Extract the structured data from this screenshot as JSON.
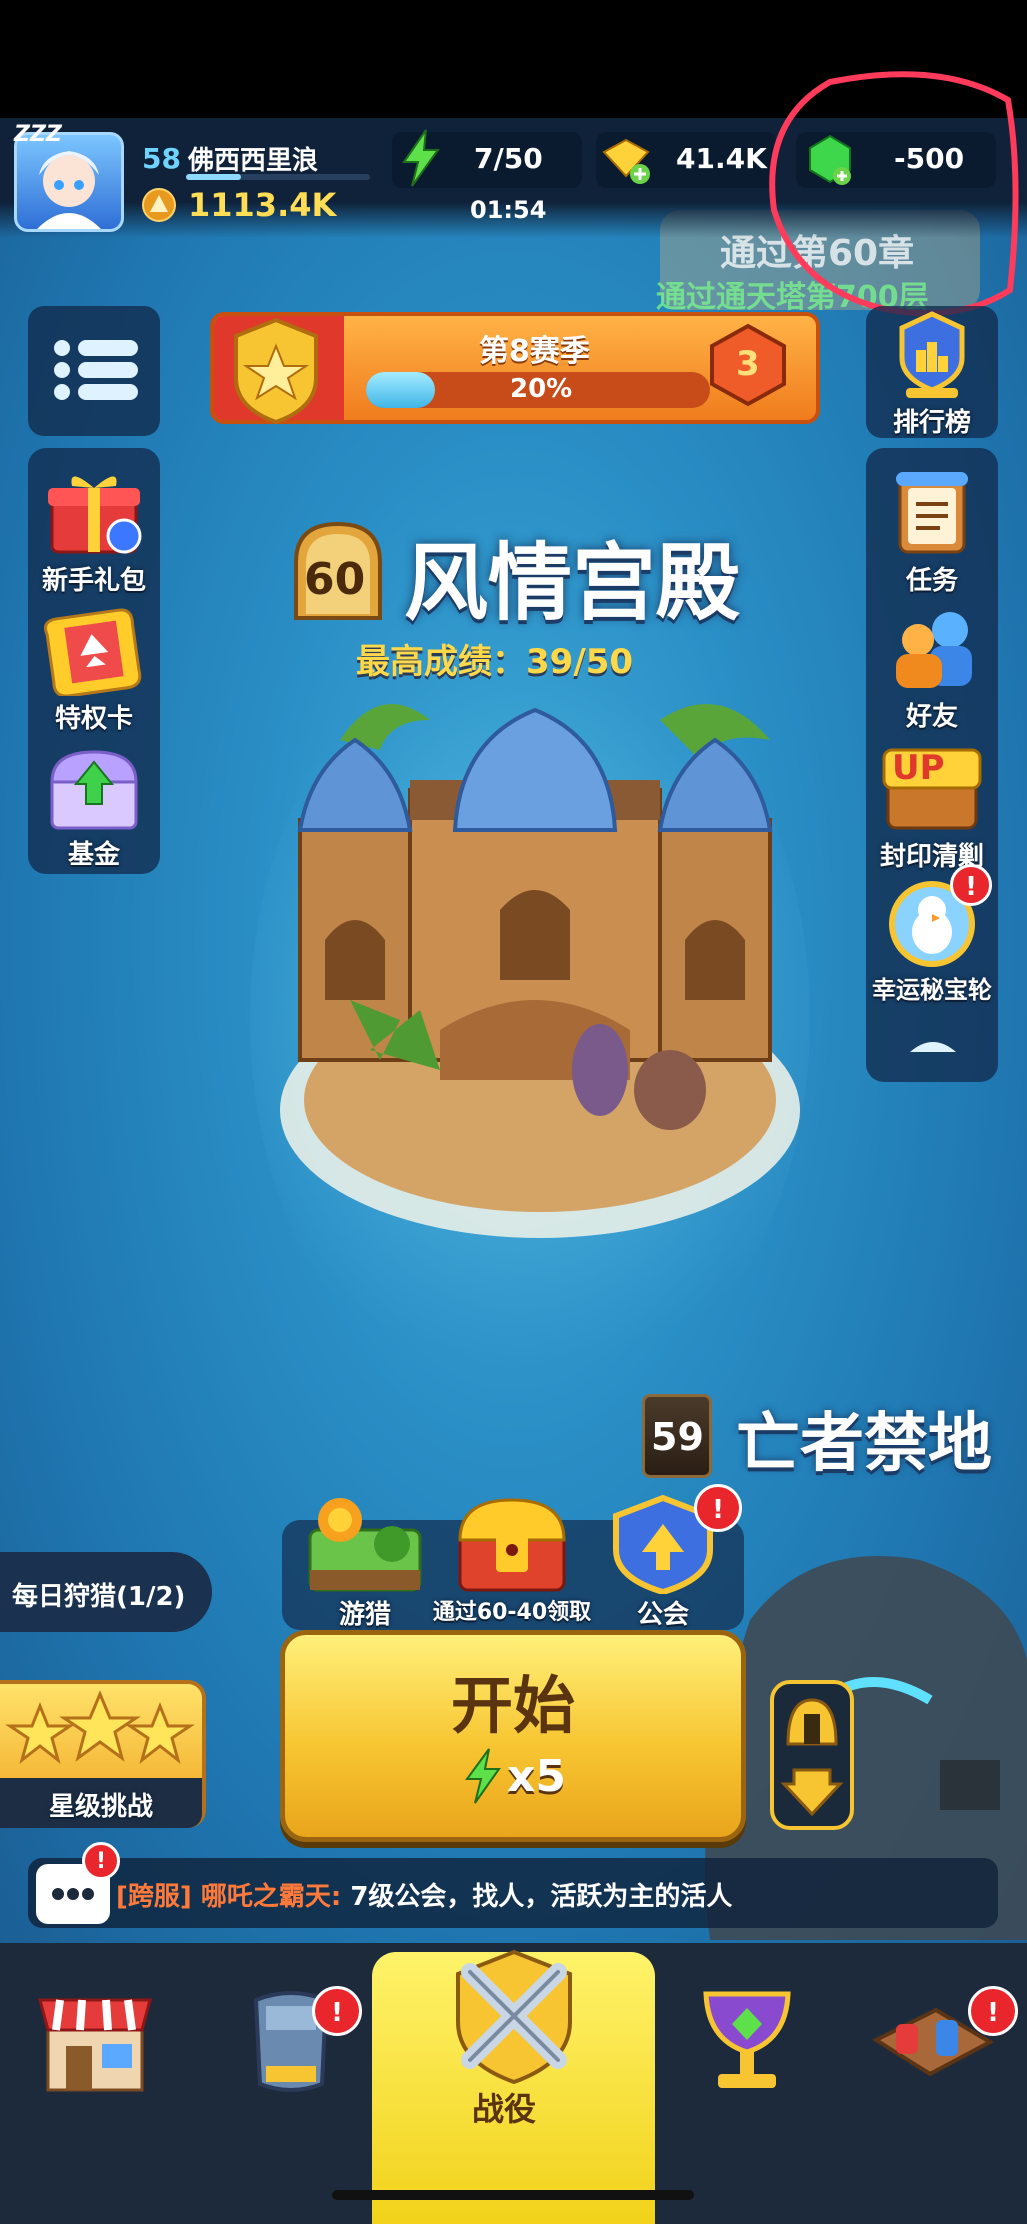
{
  "player": {
    "level": "58",
    "name": "佛西西里浪",
    "power": "1113.4K",
    "sleep": "ZZZ"
  },
  "resources": {
    "energy": "7/50",
    "energy_timer": "01:54",
    "gold": "41.4K",
    "gems": "-500"
  },
  "quest_hint": {
    "line1": "通过第60章",
    "line2": "通过通天塔第700层"
  },
  "season": {
    "title": "第8赛季",
    "progress_text": "20%",
    "progress": 0.2,
    "level": "3"
  },
  "left_menu": [
    {
      "label": "新手礼包"
    },
    {
      "label": "特权卡"
    },
    {
      "label": "基金"
    }
  ],
  "right_menu": {
    "ranking": "排行榜",
    "items": [
      {
        "label": "任务"
      },
      {
        "label": "好友"
      },
      {
        "label": "封印清剿"
      },
      {
        "label": "幸运秘宝轮"
      }
    ],
    "up_text": "UP"
  },
  "chapter": {
    "number": "60",
    "name": "风情宫殿",
    "best": "最高成绩：39/50"
  },
  "next_chapter": {
    "number": "59",
    "name": "亡者禁地"
  },
  "actions": [
    {
      "label": "游猎"
    },
    {
      "label": "通过60-40领取"
    },
    {
      "label": "公会"
    }
  ],
  "daily_hunt": "每日狩猎(1/2)",
  "star_challenge": "星级挑战",
  "start": {
    "label": "开始",
    "cost": "x5"
  },
  "chat": {
    "channel": "[跨服]",
    "sender": "哪吒之霸天:",
    "message": "7级公会，找人，活跃为主的活人"
  },
  "nav": {
    "active_label": "战役"
  },
  "alert_mark": "!",
  "colors": {
    "accent_yellow": "#f7c531",
    "alert_red": "#e8262b",
    "ocean": "#2a8fc6"
  }
}
